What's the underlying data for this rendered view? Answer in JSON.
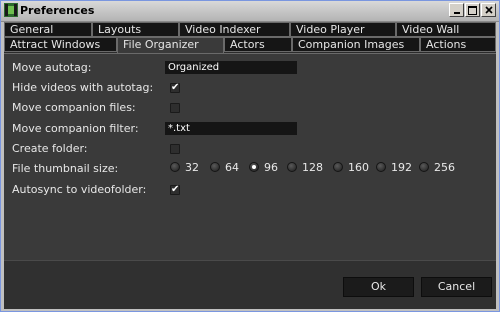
{
  "window": {
    "title": "Preferences"
  },
  "tabs": {
    "row_back": [
      "General",
      "Layouts",
      "Video Indexer",
      "Video Player",
      "Video Wall"
    ],
    "row_front": [
      "Attract Windows",
      "File Organizer",
      "Actors",
      "Companion Images",
      "Actions"
    ],
    "active": "File Organizer"
  },
  "settings": {
    "move_autotag": {
      "label": "Move autotag:",
      "value": "Organized"
    },
    "hide_videos_with_autotag": {
      "label": "Hide videos with autotag:",
      "checked": true
    },
    "move_companion_files": {
      "label": "Move companion files:",
      "checked": false
    },
    "move_companion_filter": {
      "label": "Move companion filter:",
      "value": "*.txt"
    },
    "create_folder": {
      "label": "Create folder:",
      "checked": false
    },
    "file_thumbnail_size": {
      "label": "File thumbnail size:",
      "options": [
        "32",
        "64",
        "96",
        "128",
        "160",
        "192",
        "256"
      ],
      "selected": "96"
    },
    "autosync_to_videofolder": {
      "label": "Autosync to videofolder:",
      "checked": true
    }
  },
  "footer": {
    "ok_label": "Ok",
    "cancel_label": "Cancel"
  },
  "colors": {
    "panel": "#3a3a3a",
    "tab_inactive": "#151515",
    "text": "#e8e8e8"
  }
}
